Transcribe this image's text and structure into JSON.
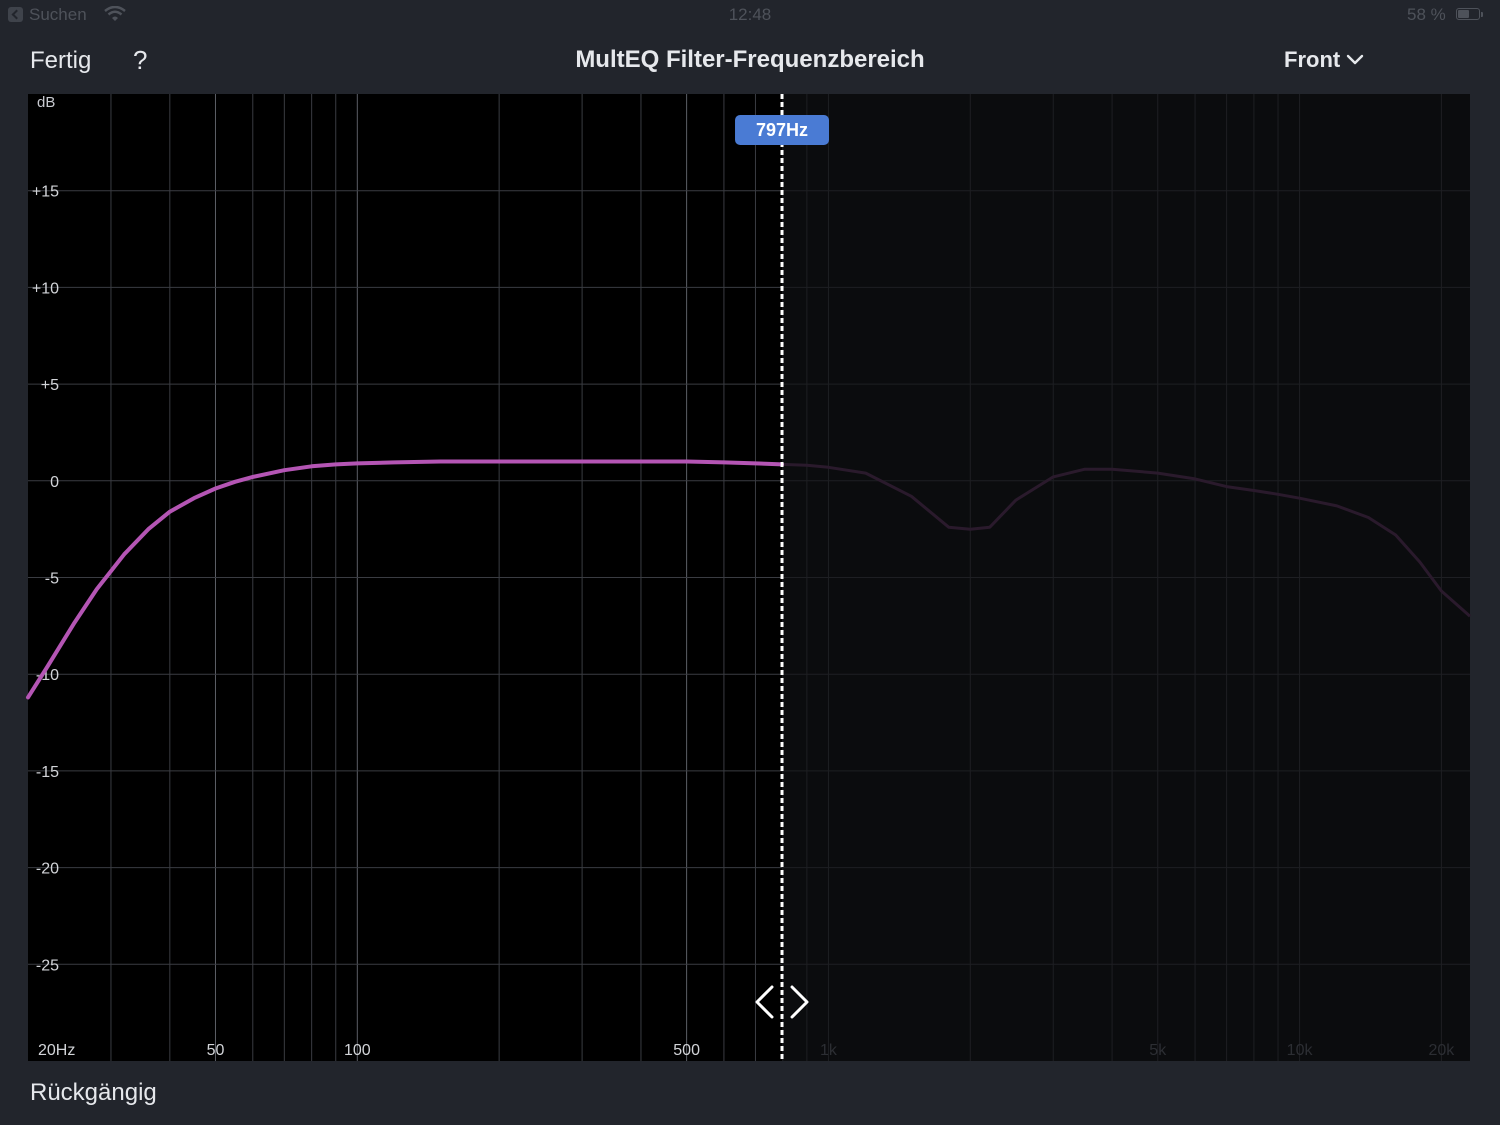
{
  "status_bar": {
    "back_app": "Suchen",
    "time": "12:48",
    "battery_text": "58 %",
    "battery_level": 0.58
  },
  "nav": {
    "done_label": "Fertig",
    "help_label": "?",
    "title": "MultEQ Filter-Frequenzbereich",
    "channel_label": "Front"
  },
  "footer": {
    "undo_label": "Rückgängig"
  },
  "colors": {
    "curve_active": "#b455b4",
    "curve_inactive": "#2a1a2c",
    "marker_badge": "#4a7bd4"
  },
  "chart_data": {
    "type": "line",
    "title": "",
    "xlabel": "",
    "ylabel": "dB",
    "x_scale": "log",
    "xlim": [
      20,
      23000
    ],
    "ylim": [
      -30,
      20
    ],
    "y_ticks": [
      {
        "value": 15,
        "label": "+15"
      },
      {
        "value": 10,
        "label": "+10"
      },
      {
        "value": 5,
        "label": "+5"
      },
      {
        "value": 0,
        "label": "0"
      },
      {
        "value": -5,
        "label": "-5"
      },
      {
        "value": -10,
        "label": "-10"
      },
      {
        "value": -15,
        "label": "-15"
      },
      {
        "value": -20,
        "label": "-20"
      },
      {
        "value": -25,
        "label": "-25"
      }
    ],
    "x_ticks": [
      {
        "value": 20,
        "label": "20Hz",
        "dim": false
      },
      {
        "value": 50,
        "label": "50",
        "dim": false
      },
      {
        "value": 100,
        "label": "100",
        "dim": false
      },
      {
        "value": 500,
        "label": "500",
        "dim": false
      },
      {
        "value": 1000,
        "label": "1k",
        "dim": true
      },
      {
        "value": 5000,
        "label": "5k",
        "dim": true
      },
      {
        "value": 10000,
        "label": "10k",
        "dim": true
      },
      {
        "value": 20000,
        "label": "20k",
        "dim": true
      }
    ],
    "grid": true,
    "cutoff_frequency_hz": 797,
    "cutoff_label": "797Hz",
    "series": [
      {
        "x": [
          20,
          22,
          25,
          28,
          32,
          36,
          40,
          45,
          50,
          55,
          60,
          70,
          80,
          90,
          100,
          120,
          150,
          200,
          300,
          400,
          500,
          600,
          700,
          797,
          900,
          1000,
          1200,
          1500,
          1800,
          2000,
          2200,
          2500,
          3000,
          3500,
          4000,
          5000,
          6000,
          7000,
          8000,
          9000,
          10000,
          12000,
          14000,
          16000,
          18000,
          20000,
          23000
        ],
        "y": [
          -11.2,
          -9.6,
          -7.4,
          -5.6,
          -3.8,
          -2.5,
          -1.6,
          -0.9,
          -0.4,
          -0.05,
          0.2,
          0.55,
          0.75,
          0.85,
          0.9,
          0.95,
          1.0,
          1.0,
          1.0,
          1.0,
          1.0,
          0.95,
          0.9,
          0.85,
          0.8,
          0.7,
          0.4,
          -0.8,
          -2.4,
          -2.5,
          -2.4,
          -1.0,
          0.2,
          0.6,
          0.6,
          0.4,
          0.1,
          -0.3,
          -0.5,
          -0.7,
          -0.9,
          -1.3,
          -1.9,
          -2.8,
          -4.2,
          -5.7,
          -7.0
        ]
      }
    ]
  }
}
